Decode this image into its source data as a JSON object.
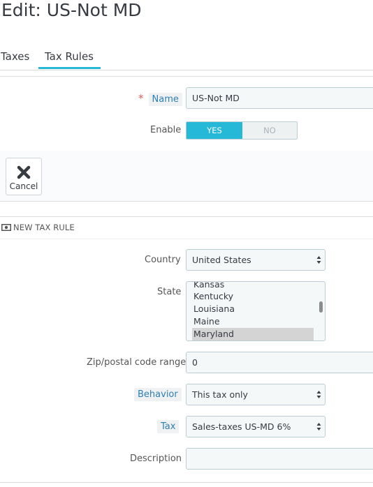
{
  "page": {
    "title": "Edit: US-Not MD"
  },
  "tabs": [
    {
      "label": "Taxes",
      "active": false
    },
    {
      "label": "Tax Rules",
      "active": true
    }
  ],
  "form": {
    "name_required": "*",
    "name_label": "Name",
    "name_value": "US-Not MD",
    "enable_label": "Enable",
    "enable_yes": "YES",
    "enable_no": "NO",
    "enable_value": "YES"
  },
  "cancel_button": {
    "label": "Cancel",
    "icon": "close-icon"
  },
  "new_tax_rule": {
    "header": "NEW TAX RULE",
    "header_icon": "money-icon",
    "country_label": "Country",
    "country_value": "United States",
    "state_label": "State",
    "state_options": [
      "Kansas",
      "Kentucky",
      "Louisiana",
      "Maine",
      "Maryland"
    ],
    "state_selected": "Maryland",
    "zip_label": "Zip/postal code range",
    "zip_value": "0",
    "behavior_label": "Behavior",
    "behavior_value": "This tax only",
    "tax_label": "Tax",
    "tax_value": "Sales-taxes US-MD 6%",
    "description_label": "Description",
    "description_value": ""
  },
  "colors": {
    "accent": "#25b9d7",
    "hint_text": "#2e7fb5",
    "required": "#e05d5d"
  }
}
